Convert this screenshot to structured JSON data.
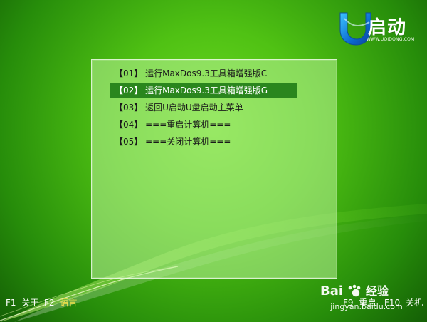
{
  "brand": {
    "name": "启动",
    "url": "WWW.UQIDONG.COM"
  },
  "menu": {
    "items": [
      {
        "label": "【01】 运行MaxDos9.3工具箱增强版C"
      },
      {
        "label": "【02】 运行MaxDos9.3工具箱增强版G",
        "selected": true
      },
      {
        "label": "【03】 返回U启动U盘启动主菜单"
      },
      {
        "label": "【04】 ===重启计算机==="
      },
      {
        "label": "【05】 ===关闭计算机==="
      }
    ]
  },
  "footer": {
    "f1": {
      "key": "F1",
      "label": "关于"
    },
    "f2": {
      "key": "F2",
      "label": "语言"
    },
    "f9": {
      "key": "F9",
      "label": "重启"
    },
    "f10": {
      "key": "F10",
      "label": "关机"
    }
  },
  "watermark": {
    "brand": "Bai 经验",
    "site": "jingyan.baidu.com"
  },
  "colors": {
    "background_bright": "#61d31d",
    "background_dark": "#1c6c07",
    "panel": "#c0f5a0",
    "selected_bg": "#2a861d",
    "text_dark": "#1a1a1a",
    "text_light": "#ffffff",
    "accent_yellow": "#f2e14b"
  }
}
